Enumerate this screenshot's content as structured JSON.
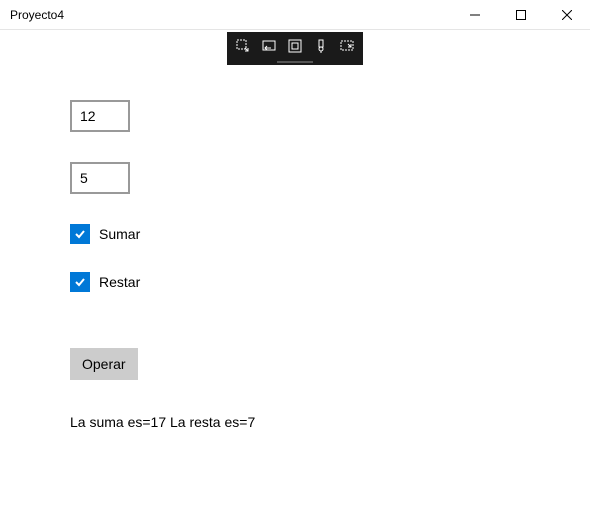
{
  "window": {
    "title": "Proyecto4"
  },
  "inputs": {
    "value1": "12",
    "value2": "5"
  },
  "checkboxes": {
    "sumar": {
      "label": "Sumar",
      "checked": true
    },
    "restar": {
      "label": "Restar",
      "checked": true
    }
  },
  "buttons": {
    "operate": "Operar"
  },
  "result": "La suma es=17 La resta es=7",
  "colors": {
    "accent": "#0078d7"
  }
}
